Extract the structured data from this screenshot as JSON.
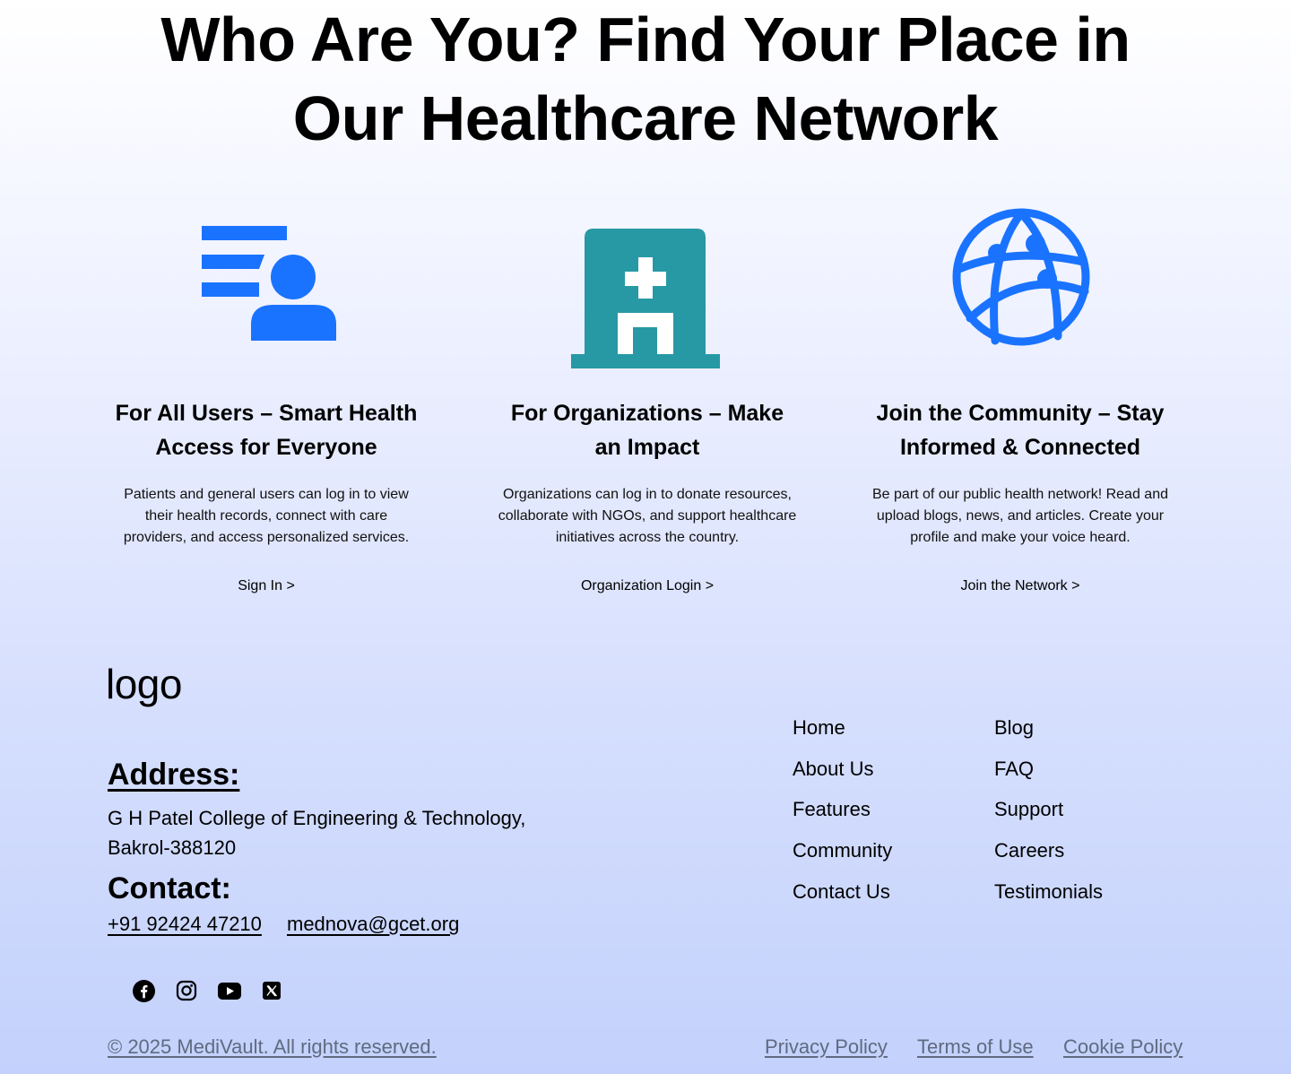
{
  "hero": {
    "title_line1": "Who Are You? Find Your Place in",
    "title_line2": "Our Healthcare Network"
  },
  "cards": [
    {
      "icon": "user-list-icon",
      "icon_color": "#1a73ff",
      "title_line1": "For All Users – Smart Health",
      "title_line2": "Access for Everyone",
      "desc_lines": [
        "Patients and general users can log in to view",
        "their health records, connect with care",
        "providers, and access personalized services."
      ],
      "link": "Sign In >"
    },
    {
      "icon": "hospital-icon",
      "icon_color": "#2799a5",
      "title_line1": "For Organizations – Make",
      "title_line2": "an Impact",
      "desc_lines": [
        "Organizations can log in to donate resources,",
        "collaborate with NGOs, and support healthcare",
        "initiatives across the country."
      ],
      "link": "Organization Login >"
    },
    {
      "icon": "globe-network-icon",
      "icon_color": "#1a73ff",
      "title_line1": "Join the Community – Stay",
      "title_line2": "Informed & Connected",
      "desc_lines": [
        "Be part of our public health network! Read and",
        "upload blogs, news, and articles. Create your",
        "profile and make your voice heard."
      ],
      "link": "Join the Network >"
    }
  ],
  "footer": {
    "logo": "logo",
    "address_label": "Address:",
    "address_line1": "G H Patel College of Engineering & Technology,",
    "address_line2": "Bakrol-388120",
    "contact_label": "Contact:",
    "phone": "+91 92424 47210",
    "email": "mednova@gcet.org",
    "socials": [
      "facebook-icon",
      "instagram-icon",
      "youtube-icon",
      "x-twitter-icon"
    ],
    "nav_col1": [
      "Home",
      "About Us",
      "Features",
      "Community",
      "Contact Us"
    ],
    "nav_col2": [
      "Blog",
      "FAQ",
      "Support",
      "Careers",
      "Testimonials"
    ],
    "copyright": "© 2025 MediVault. All rights reserved.",
    "legal": [
      "Privacy Policy",
      "Terms of Use",
      "Cookie Policy"
    ]
  }
}
